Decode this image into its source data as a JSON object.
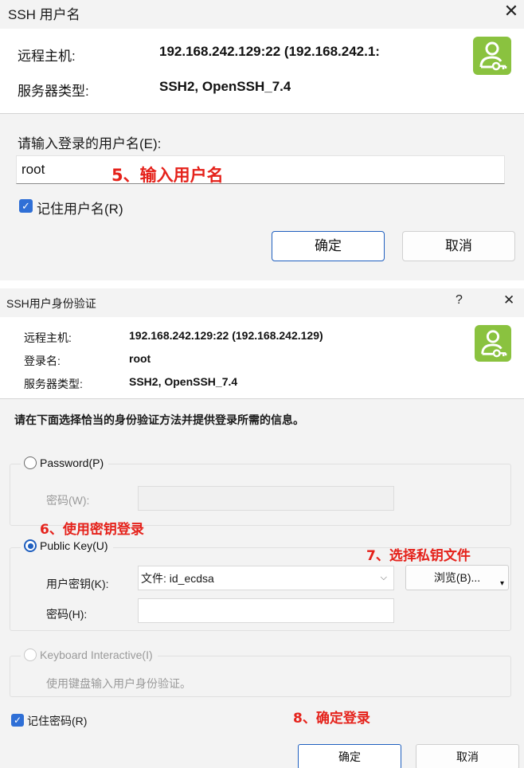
{
  "dialog1": {
    "title": "SSH 用户名",
    "close_glyph": "✕",
    "remote_label": "远程主机:",
    "remote_value": "192.168.242.129:22 (192.168.242.1:",
    "server_type_label": "服务器类型:",
    "server_type_value": "SSH2, OpenSSH_7.4",
    "prompt": "请输入登录的用户名(E):",
    "username_value": "root",
    "annotation": "5、输入用户名",
    "remember_label": "记住用户名(R)",
    "remember_checked": true,
    "ok_label": "确定",
    "cancel_label": "取消",
    "icon": "user-key-icon"
  },
  "dialog2": {
    "title": "SSH用户身份验证",
    "help_glyph": "?",
    "close_glyph": "✕",
    "remote_label": "远程主机:",
    "remote_value": "192.168.242.129:22 (192.168.242.129)",
    "login_label": "登录名:",
    "login_value": "root",
    "server_type_label": "服务器类型:",
    "server_type_value": "SSH2, OpenSSH_7.4",
    "instruction": "请在下面选择恰当的身份验证方法并提供登录所需的信息。",
    "password_option": "Password(P)",
    "password_field_label": "密码(W):",
    "annotation_use_key": "6、使用密钥登录",
    "publickey_option": "Public Key(U)",
    "annotation_choose_key": "7、选择私钥文件",
    "user_key_label": "用户密钥(K):",
    "user_key_value": "文件: id_ecdsa",
    "browse_label": "浏览(B)...",
    "passphrase_label": "密码(H):",
    "keyboard_option": "Keyboard Interactive(I)",
    "keyboard_desc": "使用键盘输入用户身份验证。",
    "remember_password_label": "记住密码(R)",
    "remember_checked": true,
    "annotation_confirm": "8、确定登录",
    "ok_label": "确定",
    "cancel_label": "取消",
    "icon": "user-key-icon"
  },
  "colors": {
    "accent": "#1f5fbf",
    "icon_green": "#8ac23f",
    "annotation_red": "#e5221b"
  }
}
